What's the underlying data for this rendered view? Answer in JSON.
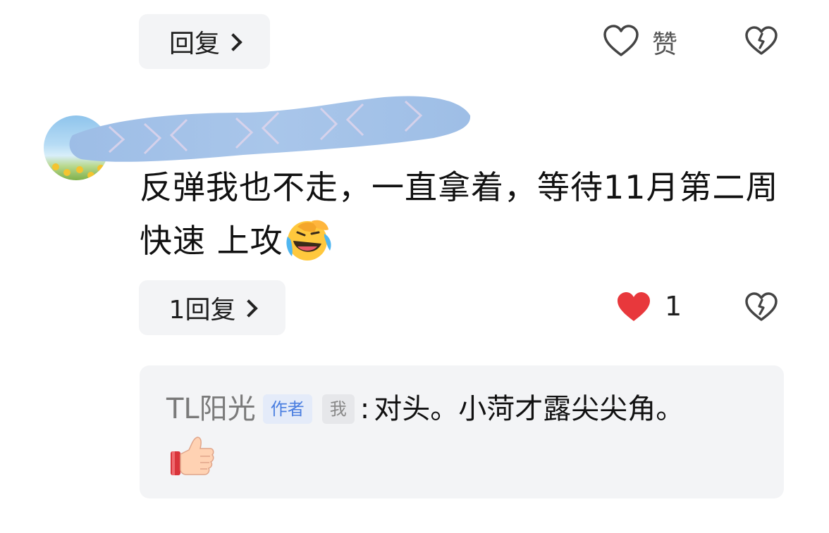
{
  "top_reply_button": {
    "label": "回复"
  },
  "top_actions": {
    "like_label": "赞",
    "like_icon": "heart-outline-icon",
    "dislike_icon": "broken-heart-icon"
  },
  "comment": {
    "text": "反弹我也不走，一直拿着，等待11月第二周快速 上攻",
    "emoji": "rolling-laughing-emoji",
    "reply_button": {
      "label": "1回复"
    },
    "like_count": "1",
    "like_icon": "heart-filled-icon",
    "like_color": "#e8383c",
    "dislike_icon": "broken-heart-icon"
  },
  "nested_reply": {
    "user": "TL阳光",
    "author_tag": "作者",
    "me_tag": "我",
    "colon": ":",
    "text": "对头。小菏才露尖尖角。",
    "emoji": "thumbs-up-emoji"
  }
}
